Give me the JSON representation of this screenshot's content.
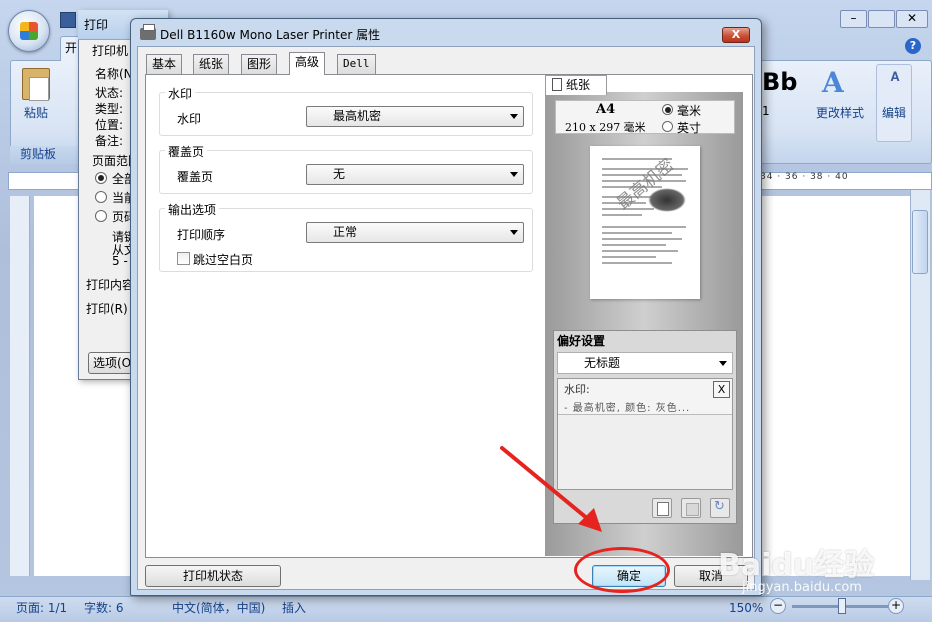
{
  "word": {
    "tab_start": "开",
    "paste_label": "粘贴",
    "clipboard_group": "剪贴板",
    "styles_preview": "Bb",
    "styles_index": "1",
    "change_styles": "更改样式",
    "edit_label": "编辑",
    "help_glyph": "?",
    "ruler_numbers": "34 · 36 · 38 · 40",
    "status": {
      "page": "页面: 1/1",
      "words": "字数: 6",
      "language": "中文(简体，中国)",
      "insert": "插入",
      "zoom": "150%"
    }
  },
  "print_dialog": {
    "title": "打印",
    "printer_section": "打印机",
    "name_label": "名称(N",
    "status_label": "状态:",
    "type_label": "类型:",
    "where_label": "位置:",
    "comment_label": "备注:",
    "page_range": "页面范围",
    "opt_all": "全部",
    "opt_current": "当前",
    "opt_pages": "页码",
    "hint_line1": "请键",
    "hint_line2": "从文",
    "hint_line3": "5 -",
    "print_what": "打印内容",
    "print_label": "打印(R)",
    "options_button": "选项(O"
  },
  "props_dialog": {
    "title": "Dell B1160w Mono Laser Printer 属性",
    "close_glyph": "X",
    "tabs": [
      {
        "label": "基本"
      },
      {
        "label": "纸张"
      },
      {
        "label": "图形"
      },
      {
        "label": "高级"
      },
      {
        "label": "Dell"
      }
    ],
    "active_tab": "高级",
    "watermark_group": {
      "title": "水印",
      "label": "水印",
      "value": "最高机密"
    },
    "overlay_group": {
      "title": "覆盖页",
      "label": "覆盖页",
      "value": "无"
    },
    "output_group": {
      "title": "输出选项",
      "order_label": "打印顺序",
      "order_value": "正常",
      "skip_blank": "跳过空白页"
    },
    "preview": {
      "tab_label": "纸张",
      "paper_name": "A4",
      "paper_dims": "210 x 297 毫米",
      "unit_mm": "毫米",
      "unit_inch": "英寸",
      "unit_selected": "毫米",
      "watermark_text": "最高机密"
    },
    "preferences": {
      "title": "偏好设置",
      "selected": "无标题",
      "item_title": "水印:",
      "item_desc": "- 最高机密, 颜色: 灰色...",
      "delete_glyph": "X"
    },
    "buttons": {
      "printer_status": "打印机状态",
      "ok": "确定",
      "cancel": "取消"
    }
  },
  "overlay_watermark": {
    "brand": "Baidu经验",
    "url": "jingyan.baidu.com"
  },
  "colors": {
    "annotation": "#e5241f",
    "title_bar": "#c9d9ee",
    "close_button": "#c74b33"
  }
}
